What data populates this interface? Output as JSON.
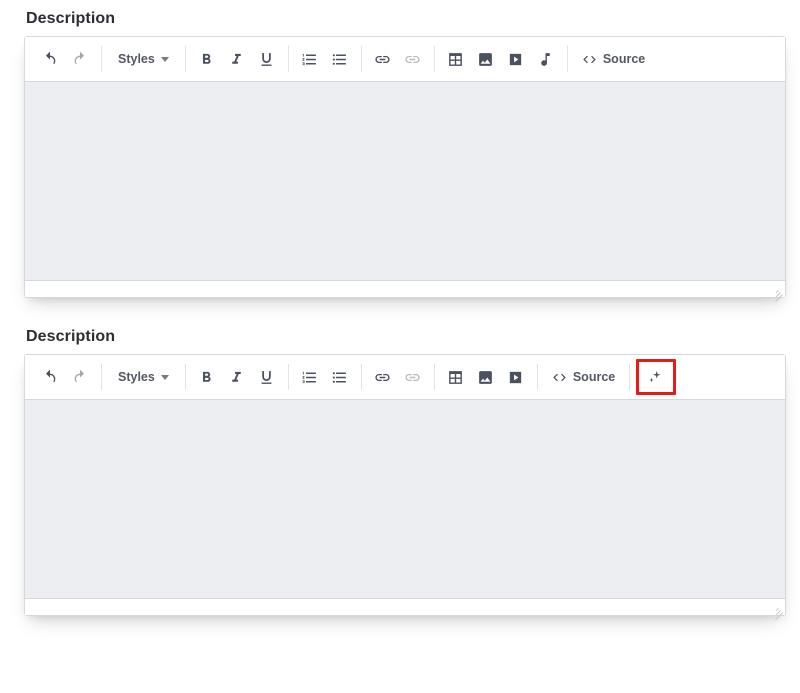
{
  "editor1": {
    "label": "Description",
    "styles_label": "Styles",
    "source_label": "Source"
  },
  "editor2": {
    "label": "Description",
    "styles_label": "Styles",
    "source_label": "Source"
  }
}
